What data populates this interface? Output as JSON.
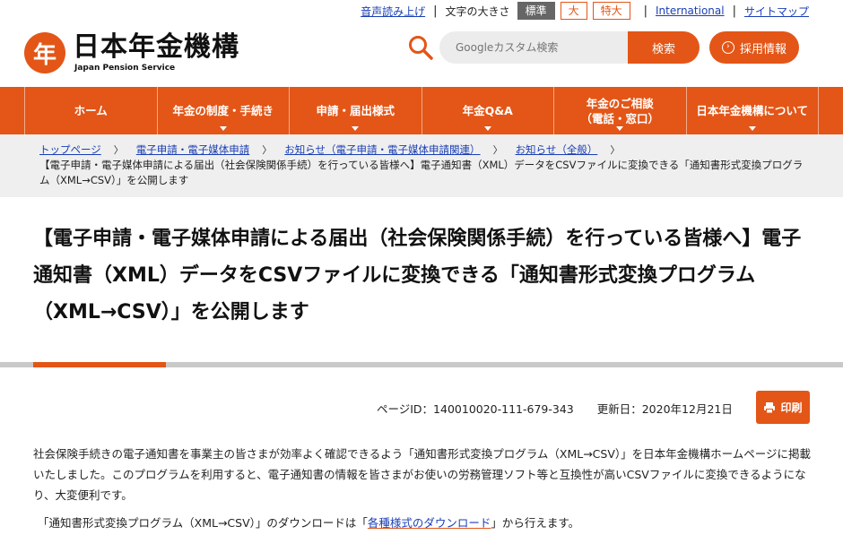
{
  "utility": {
    "read_aloud": "音声読み上げ",
    "text_size_label": "文字の大きさ",
    "sizes": [
      "標準",
      "大",
      "特大"
    ],
    "international": "International",
    "sitemap": "サイトマップ"
  },
  "header": {
    "logo_title": "日本年金機構",
    "logo_subtitle": "Japan Pension Service",
    "logo_mark": "年",
    "search_placeholder": "Googleカスタム検索",
    "search_button": "検索",
    "recruit_button": "採用情報"
  },
  "nav": {
    "items": [
      {
        "label": "ホーム"
      },
      {
        "label": "年金の制度・手続き"
      },
      {
        "label": "申請・届出様式"
      },
      {
        "label": "年金Q&A"
      },
      {
        "label": "年金のご相談\n（電話・窓口）"
      },
      {
        "label": "日本年金機構について"
      }
    ]
  },
  "breadcrumb": {
    "links": [
      "トップページ",
      "電子申請・電子媒体申請",
      "お知らせ（電子申請・電子媒体申請関連）",
      "お知らせ（全般）"
    ],
    "current": "【電子申請・電子媒体申請による届出（社会保険関係手続）を行っている皆様へ】電子通知書（XML）データをCSVファイルに変換できる「通知書形式変換プログラム（XML→CSV）」を公開します"
  },
  "page": {
    "title": "【電子申請・電子媒体申請による届出（社会保険関係手続）を行っている皆様へ】電子通知書（XML）データをCSVファイルに変換できる「通知書形式変換プログラム（XML→CSV）」を公開します",
    "page_id": "ページID：140010020-111-679-343",
    "updated": "更新日：2020年12月21日",
    "print_button": "印刷",
    "body": "社会保険手続きの電子通知書を事業主の皆さまが効率よく確認できるよう「通知書形式変換プログラム（XML→CSV）」を日本年金機構ホームページに掲載いたしました。このプログラムを利用すると、電子通知書の情報を皆さまがお使いの労務管理ソフト等と互換性が高いCSVファイルに変換できるようになり、大変便利です。",
    "download_prefix": "「通知書形式変換プログラム（XML→CSV）」のダウンロードは「",
    "download_link": "各種様式のダウンロード",
    "download_suffix": "」から行えます。"
  },
  "colors": {
    "brand": "#e35617",
    "link": "#1a3fb5",
    "crumb_bg": "#efefef"
  }
}
